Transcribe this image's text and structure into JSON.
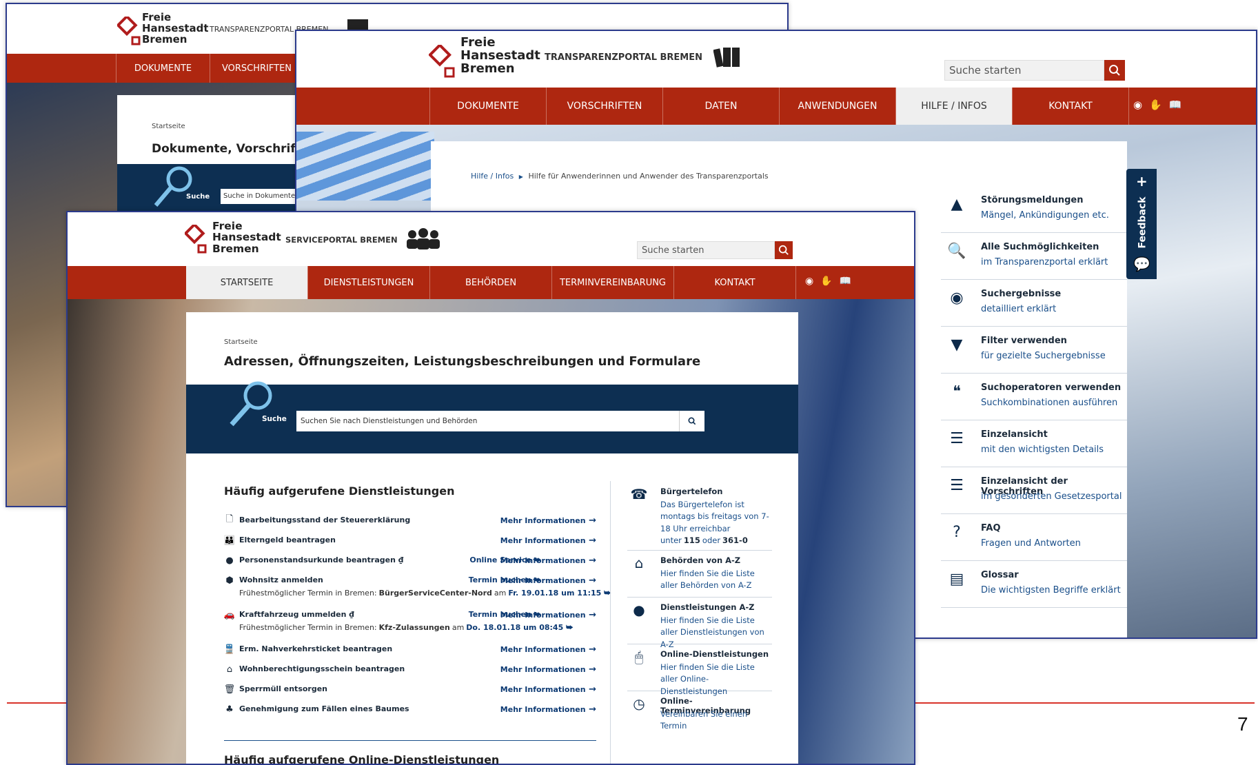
{
  "back_window": {
    "logo": {
      "line1": "Freie",
      "line2": "Hansestadt",
      "line3": "Bremen"
    },
    "portal": "TRANSPARENZPORTAL BREMEN",
    "nav": [
      "DOKUMENTE",
      "VORSCHRIFTEN"
    ],
    "breadcrumb": "Startseite",
    "heading": "Dokumente, Vorschrifte",
    "search_label": "Suche",
    "search_placeholder": "Suche in Dokumenten,"
  },
  "mid_window": {
    "logo": {
      "line1": "Freie",
      "line2": "Hansestadt",
      "line3": "Bremen"
    },
    "portal": "TRANSPARENZPORTAL BREMEN",
    "search_placeholder": "Suche starten",
    "nav": [
      {
        "label": "DOKUMENTE",
        "active": false
      },
      {
        "label": "VORSCHRIFTEN",
        "active": false
      },
      {
        "label": "DATEN",
        "active": false
      },
      {
        "label": "ANWENDUNGEN",
        "active": false
      },
      {
        "label": "HILFE / INFOS",
        "active": true
      },
      {
        "label": "KONTAKT",
        "active": false
      }
    ],
    "breadcrumb_root": "Hilfe / Infos",
    "breadcrumb_sep": "▶",
    "breadcrumb_current": "Hilfe für Anwenderinnen und Anwender des Transparenzportals",
    "feedback_label": "Feedback",
    "help_items": [
      {
        "icon": "warning-icon",
        "glyph": "▲",
        "title": "Störungsmeldungen",
        "desc": "Mängel, Ankündigungen etc."
      },
      {
        "icon": "search-icon",
        "glyph": "🔍",
        "title": "Alle Suchmöglichkeiten",
        "desc": "im Transparenzportal erklärt"
      },
      {
        "icon": "target-icon",
        "glyph": "◉",
        "title": "Suchergebnisse",
        "desc": "detailliert erklärt"
      },
      {
        "icon": "filter-icon",
        "glyph": "▼",
        "title": "Filter verwenden",
        "desc": "für gezielte Suchergebnisse"
      },
      {
        "icon": "quote-icon",
        "glyph": "❝",
        "title": "Suchoperatoren verwenden",
        "desc": "Suchkombinationen ausführen"
      },
      {
        "icon": "list-icon",
        "glyph": "☰",
        "title": "Einzelansicht",
        "desc": "mit den wichtigsten Details"
      },
      {
        "icon": "numbered-list-icon",
        "glyph": "☰",
        "title": "Einzelansicht der Vorschriften",
        "desc": "im gesonderten Gesetzesportal"
      },
      {
        "icon": "help-circle-icon",
        "glyph": "?",
        "title": "FAQ",
        "desc": "Fragen und Antworten"
      },
      {
        "icon": "glossary-icon",
        "glyph": "▤",
        "title": "Glossar",
        "desc": "Die wichtigsten Begriffe erklärt"
      }
    ]
  },
  "front_window": {
    "logo": {
      "line1": "Freie",
      "line2": "Hansestadt",
      "line3": "Bremen"
    },
    "portal": "SERVICEPORTAL BREMEN",
    "search_placeholder": "Suche starten",
    "nav": [
      {
        "label": "STARTSEITE",
        "active": true
      },
      {
        "label": "DIENSTLEISTUNGEN",
        "active": false
      },
      {
        "label": "BEHÖRDEN",
        "active": false
      },
      {
        "label": "TERMINVEREINBARUNG",
        "active": false
      },
      {
        "label": "KONTAKT",
        "active": false
      }
    ],
    "breadcrumb": "Startseite",
    "heading": "Adressen, Öffnungszeiten, Leistungsbeschreibungen und Formulare",
    "search_label": "Suche",
    "search_placeholder_main": "Suchen Sie nach Dienstleistungen und Behörden",
    "section_title": "Häufig aufgerufene Dienstleistungen",
    "more_info": "Mehr Informationen",
    "services": [
      {
        "icon": "document-icon",
        "glyph": "🗋",
        "label": "Bearbeitungsstand der Steuererklärung",
        "action": ""
      },
      {
        "icon": "family-icon",
        "glyph": "👪",
        "label": "Elterngeld beantragen",
        "action": ""
      },
      {
        "icon": "person-icon",
        "glyph": "●",
        "label": "Personenstandsurkunde beantragen  ₫",
        "action": "Online Service ⮩"
      },
      {
        "icon": "box-icon",
        "glyph": "⬢",
        "label": "Wohnsitz anmelden",
        "action": "Termin buchen ⮩",
        "sub_pre": "Frühestmöglicher Termin in Bremen:",
        "sub_place": "BürgerServiceCenter-Nord",
        "sub_mid": "am",
        "sub_date": "Fr. 19.01.18 um 11:15 ⮩"
      },
      {
        "icon": "car-icon",
        "glyph": "🚗",
        "label": "Kraftfahrzeug ummelden  ₫",
        "action": "Termin buchen ⮩",
        "sub_pre": "Frühestmöglicher Termin in Bremen:",
        "sub_place": "Kfz-Zulassungen",
        "sub_mid": "am",
        "sub_date": "Do. 18.01.18 um 08:45 ⮩"
      },
      {
        "icon": "train-icon",
        "glyph": "🚆",
        "label": "Erm. Nahverkehrsticket beantragen",
        "action": ""
      },
      {
        "icon": "home-icon",
        "glyph": "⌂",
        "label": "Wohnberechtigungsschein beantragen",
        "action": ""
      },
      {
        "icon": "trash-icon",
        "glyph": "🗑",
        "label": "Sperrmüll entsorgen",
        "action": ""
      },
      {
        "icon": "tree-icon",
        "glyph": "♣",
        "label": "Genehmigung zum Fällen eines Baumes",
        "action": ""
      }
    ],
    "next_section_title": "Häufig aufgerufene Online-Dienstleistungen",
    "side_items": [
      {
        "icon": "phone-icon",
        "glyph": "☎",
        "title": "Bürgertelefon",
        "desc": "Das Bürgertelefon ist montags bis freitags von 7-18 Uhr erreichbar unter",
        "num1": "115",
        "mid": "oder",
        "num2": "361-0"
      },
      {
        "icon": "building-icon",
        "glyph": "⌂",
        "title": "Behörden von A-Z",
        "desc": "Hier finden Sie die Liste aller Behörden von A-Z"
      },
      {
        "icon": "user-icon",
        "glyph": "●",
        "title": "Dienstleistungen A-Z",
        "desc": "Hier finden Sie die Liste aller Dienstleistungen von A-Z"
      },
      {
        "icon": "mouse-icon",
        "glyph": "🖱",
        "title": "Online-Dienstleistungen",
        "desc": "Hier finden Sie die Liste aller Online-Dienstleistungen"
      },
      {
        "icon": "clock-icon",
        "glyph": "◷",
        "title": "Online-Terminvereinbarung",
        "desc": "Vereinbaren Sie einen Termin"
      }
    ]
  },
  "slide_number": "7",
  "colors": {
    "nav_red": "#ae2710",
    "dark_blue": "#0d2f52",
    "link_blue": "#1a4f8a",
    "slide_line": "#d8332a"
  }
}
